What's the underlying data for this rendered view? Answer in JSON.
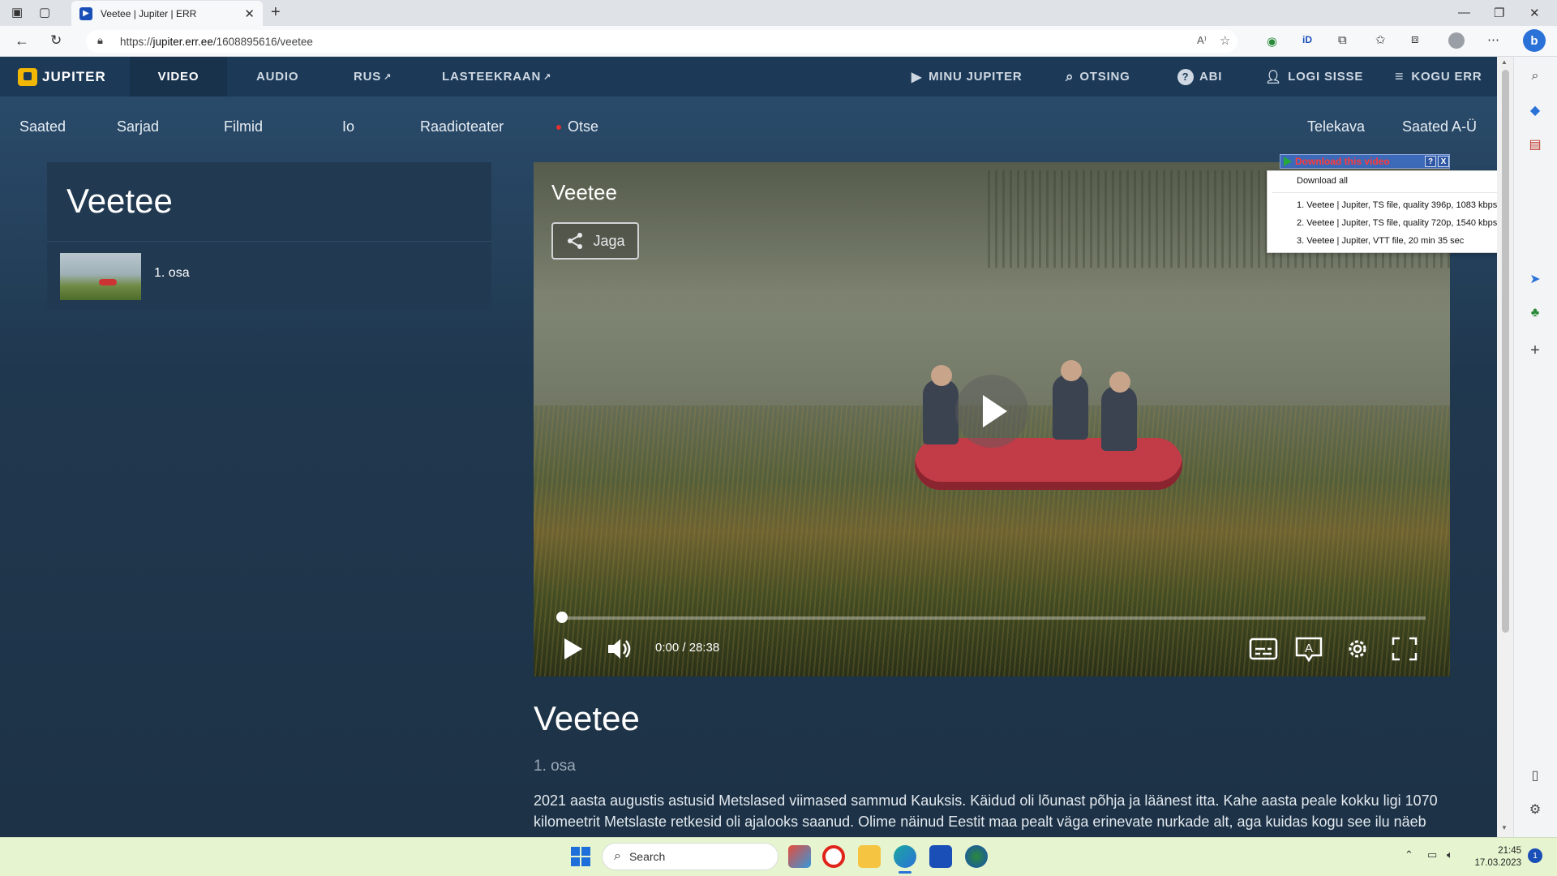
{
  "browser": {
    "tab_title": "Veetee | Jupiter | ERR",
    "url_prefix": "https://",
    "url_host": "jupiter.err.ee",
    "url_path": "/1608895616/veetee"
  },
  "nav": {
    "logo_text": "JUPITER",
    "video": "VIDEO",
    "audio": "AUDIO",
    "rus": "RUS",
    "lasteekraan": "LASTEEKRAAN",
    "minu_jupiter": "MINU JUPITER",
    "otsing": "OTSING",
    "abi": "ABI",
    "logi_sisse": "LOGI SISSE",
    "kogu_err": "KOGU ERR"
  },
  "subnav": {
    "saated": "Saated",
    "sarjad": "Sarjad",
    "filmid": "Filmid",
    "io": "Io",
    "raadioteater": "Raadioteater",
    "otse": "Otse",
    "telekava": "Telekava",
    "saated_az": "Saated A-Ü"
  },
  "left_panel": {
    "title": "Veetee",
    "episode_label": "1. osa"
  },
  "player": {
    "title": "Veetee",
    "share_label": "Jaga",
    "time": "0:00 / 28:38",
    "progress": 0.0
  },
  "downloader": {
    "header": "Download this video",
    "help": "?",
    "close": "X",
    "download_all": "Download all",
    "items": [
      "1.  Veetee | Jupiter,  TS file, quality 396p, 1083 kbps",
      "2.  Veetee | Jupiter,  TS file, quality 720p, 1540 kbps",
      "3.  Veetee | Jupiter,  VTT file, 20 min 35 sec"
    ]
  },
  "description": {
    "title": "Veetee",
    "episode": "1. osa",
    "text": "2021 aasta augustis astusid Metslased viimased sammud Kauksis. Käidud oli lõunast põhja ja läänest itta. Kahe aasta peale kokku ligi 1070 kilomeetrit Metslaste retkesid oli ajalooks saanud. Olime näinud Eestit maa pealt väga erinevate nurkade alt, aga kuidas kogu see ilu näeb"
  },
  "taskbar": {
    "search_placeholder": "Search",
    "time": "21:45",
    "date": "17.03.2023",
    "notification_count": "1"
  },
  "colors": {
    "page_bg": "#1f3449",
    "nav_bg": "#1c3a58",
    "logo_accent": "#f2b705",
    "live_dot": "#e0312f",
    "taskbar_bg": "#e6f5cf"
  }
}
